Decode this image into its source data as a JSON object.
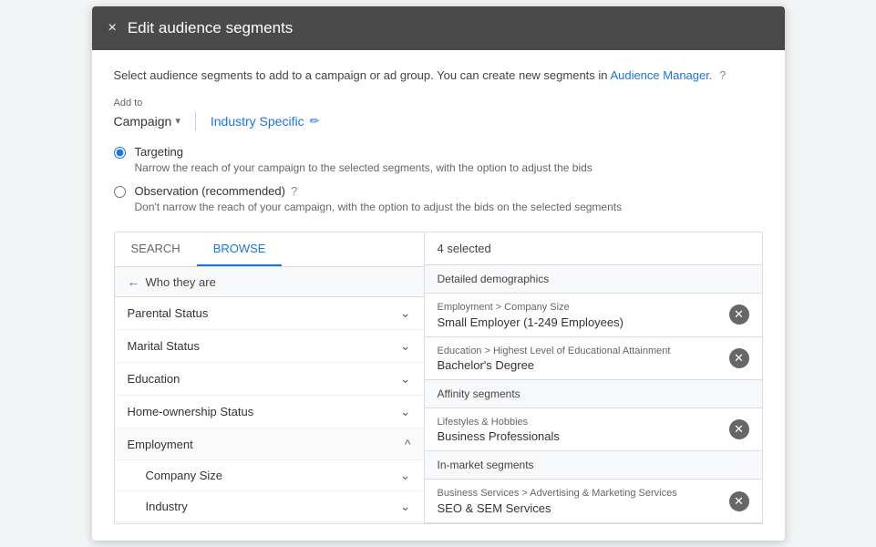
{
  "modal": {
    "title": "Edit audience segments",
    "close_label": "×"
  },
  "description": {
    "text": "Select audience segments to add to a campaign or ad group. You can create new segments in",
    "link_text": "Audience Manager.",
    "help_icon": "?"
  },
  "add_to": {
    "label": "Add to",
    "dropdown_label": "Campaign",
    "industry_specific_label": "Industry Specific",
    "edit_icon": "✏"
  },
  "targeting_options": {
    "targeting": {
      "label": "Targeting",
      "description": "Narrow the reach of your campaign to the selected segments, with the option to adjust the bids",
      "selected": true
    },
    "observation": {
      "label": "Observation (recommended)",
      "description": "Don't narrow the reach of your campaign, with the option to adjust the bids on the selected segments",
      "selected": false,
      "help_icon": "?"
    }
  },
  "tabs": {
    "search_label": "SEARCH",
    "browse_label": "BROWSE",
    "active": "browse"
  },
  "breadcrumb": {
    "back_icon": "←",
    "label": "Who they are"
  },
  "list_items": [
    {
      "label": "Parental Status",
      "expanded": false
    },
    {
      "label": "Marital Status",
      "expanded": false
    },
    {
      "label": "Education",
      "expanded": false
    },
    {
      "label": "Home-ownership Status",
      "expanded": false
    },
    {
      "label": "Employment",
      "expanded": true
    }
  ],
  "sub_items": [
    {
      "label": "Company Size"
    },
    {
      "label": "Industry"
    }
  ],
  "right_panel": {
    "selected_count": "4 selected",
    "sections": [
      {
        "header": "Detailed demographics",
        "items": [
          {
            "path": "Employment > Company Size",
            "name": "Small Employer (1-249 Employees)"
          },
          {
            "path": "Education > Highest Level of Educational Attainment",
            "name": "Bachelor's Degree"
          }
        ]
      },
      {
        "header": "Affinity segments",
        "items": [
          {
            "path": "Lifestyles & Hobbies",
            "name": "Business Professionals"
          }
        ]
      },
      {
        "header": "In-market segments",
        "items": [
          {
            "path": "Business Services > Advertising & Marketing Services",
            "name": "SEO & SEM Services"
          }
        ]
      }
    ]
  }
}
